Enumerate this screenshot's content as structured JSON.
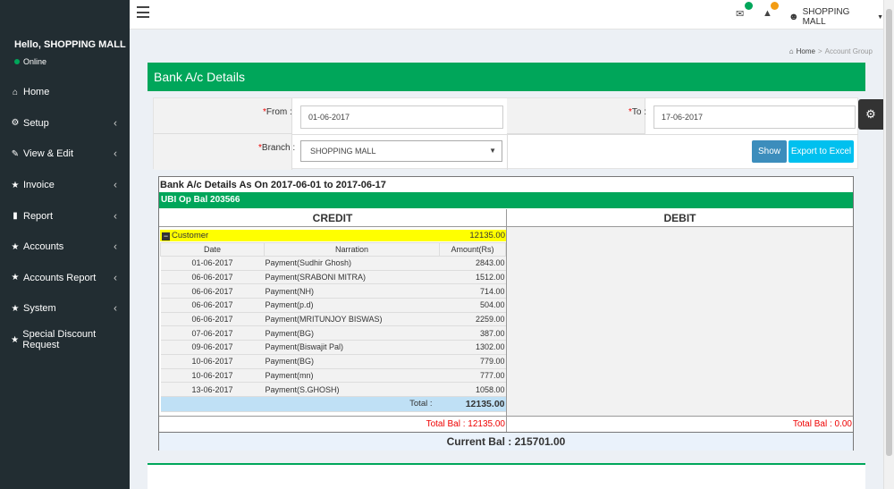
{
  "sidebar": {
    "greeting": "Hello, SHOPPING MALL",
    "status": "Online",
    "items": [
      {
        "label": "Home",
        "icon": "home-icon",
        "has_children": false
      },
      {
        "label": "Setup",
        "icon": "cogs-icon",
        "has_children": true
      },
      {
        "label": "View & Edit",
        "icon": "edit-icon",
        "has_children": true
      },
      {
        "label": "Invoice",
        "icon": "star-icon",
        "has_children": true
      },
      {
        "label": "Report",
        "icon": "file-icon",
        "has_children": true
      },
      {
        "label": "Accounts",
        "icon": "star-icon",
        "has_children": true
      },
      {
        "label": "Accounts Report",
        "icon": "star-icon",
        "has_children": true
      },
      {
        "label": "System",
        "icon": "star-icon",
        "has_children": true
      },
      {
        "label": "Special Discount Request",
        "icon": "star-icon",
        "has_children": false
      }
    ]
  },
  "topbar": {
    "user_name": "SHOPPING MALL",
    "colors": {
      "mail_badge": "#00a65a",
      "alert_badge": "#f39c12"
    }
  },
  "breadcrumb": {
    "home": "Home",
    "current": "Account Group"
  },
  "panel": {
    "title": "Bank A/c Details"
  },
  "filter": {
    "from_label": "From :",
    "from_value": "01-06-2017",
    "to_label": "To :",
    "to_value": "17-06-2017",
    "branch_label": "Branch :",
    "branch_value": "SHOPPING MALL",
    "show_label": "Show",
    "excel_label": "Export to Excel"
  },
  "report": {
    "title": "Bank A/c Details As On 2017-06-01 to 2017-06-17",
    "op_bal": "UBI Op Bal 203566",
    "credit_header": "CREDIT",
    "debit_header": "DEBIT",
    "group_name": "Customer",
    "group_amount": "12135.00",
    "columns": [
      "Date",
      "Narration",
      "Amount(Rs)"
    ],
    "rows": [
      {
        "date": "01-06-2017",
        "narration": "Payment(Sudhir Ghosh)",
        "amount": "2843.00"
      },
      {
        "date": "06-06-2017",
        "narration": "Payment(SRABONI MITRA)",
        "amount": "1512.00"
      },
      {
        "date": "06-06-2017",
        "narration": "Payment(NH)",
        "amount": "714.00"
      },
      {
        "date": "06-06-2017",
        "narration": "Payment(p.d)",
        "amount": "504.00"
      },
      {
        "date": "06-06-2017",
        "narration": "Payment(MRITUNJOY BISWAS)",
        "amount": "2259.00"
      },
      {
        "date": "07-06-2017",
        "narration": "Payment(BG)",
        "amount": "387.00"
      },
      {
        "date": "09-06-2017",
        "narration": "Payment(Biswajit Pal)",
        "amount": "1302.00"
      },
      {
        "date": "10-06-2017",
        "narration": "Payment(BG)",
        "amount": "779.00"
      },
      {
        "date": "10-06-2017",
        "narration": "Payment(mn)",
        "amount": "777.00"
      },
      {
        "date": "13-06-2017",
        "narration": "Payment(S.GHOSH)",
        "amount": "1058.00"
      }
    ],
    "total_label": "Total :",
    "total_value": "12135.00",
    "credit_total_bal": "Total Bal : 12135.00",
    "debit_total_bal": "Total Bal : 0.00",
    "current_bal": "Current Bal : 215701.00"
  },
  "colors": {
    "primary": "#00a65a",
    "sidebar": "#222d32",
    "show_btn": "#3c8dbc",
    "excel_btn": "#00c0ef",
    "group_highlight": "#ffff00",
    "negative": "#e00000"
  }
}
